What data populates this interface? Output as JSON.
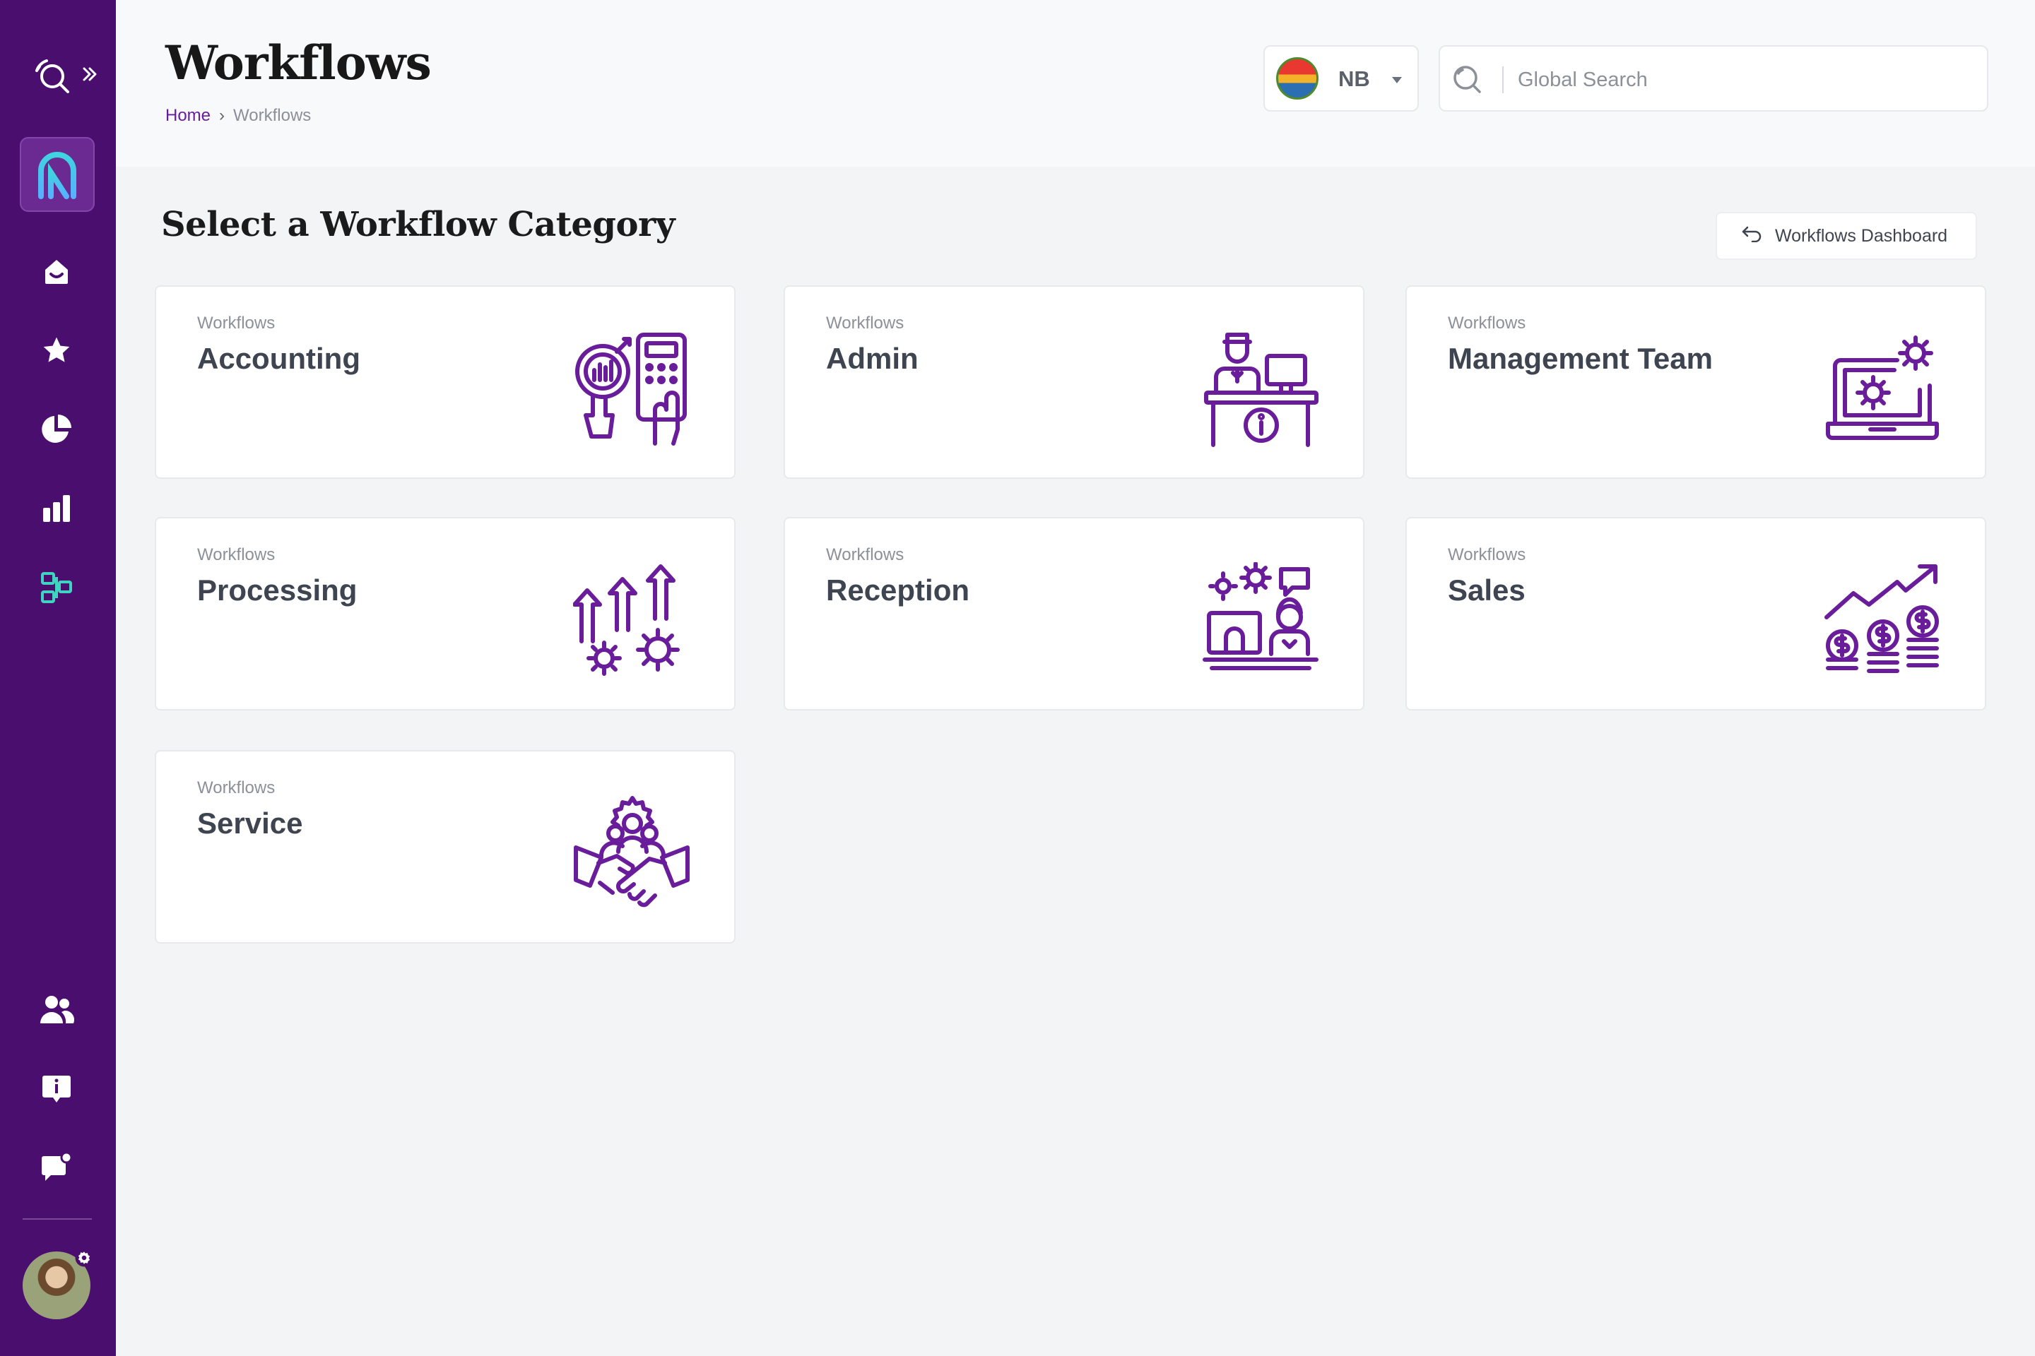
{
  "header": {
    "title": "Workflows",
    "breadcrumb": {
      "home": "Home",
      "current": "Workflows"
    },
    "region": {
      "code": "NB"
    },
    "search": {
      "placeholder": "Global Search"
    }
  },
  "main": {
    "section_title": "Select a Workflow Category",
    "dashboard_button": "Workflows Dashboard",
    "cards": [
      {
        "kicker": "Workflows",
        "name": "Accounting",
        "icon": "accounting-icon"
      },
      {
        "kicker": "Workflows",
        "name": "Admin",
        "icon": "admin-desk-icon"
      },
      {
        "kicker": "Workflows",
        "name": "Management Team",
        "icon": "laptop-gear-icon"
      },
      {
        "kicker": "Workflows",
        "name": "Processing",
        "icon": "gears-arrows-icon"
      },
      {
        "kicker": "Workflows",
        "name": "Reception",
        "icon": "reception-desk-icon"
      },
      {
        "kicker": "Workflows",
        "name": "Sales",
        "icon": "sales-growth-icon"
      },
      {
        "kicker": "Workflows",
        "name": "Service",
        "icon": "handshake-service-icon"
      }
    ]
  },
  "sidebar": {
    "items": [
      "search-icon",
      "inbox-icon",
      "star-icon",
      "pie-chart-icon",
      "bar-chart-icon",
      "workflow-icon",
      "users-icon",
      "info-icon",
      "chat-icon"
    ]
  },
  "colors": {
    "sidebar_bg": "#4a0e6e",
    "accent_purple": "#6a1d9a",
    "active_teal": "#3fd4c0",
    "page_bg": "#f2f4f6"
  }
}
